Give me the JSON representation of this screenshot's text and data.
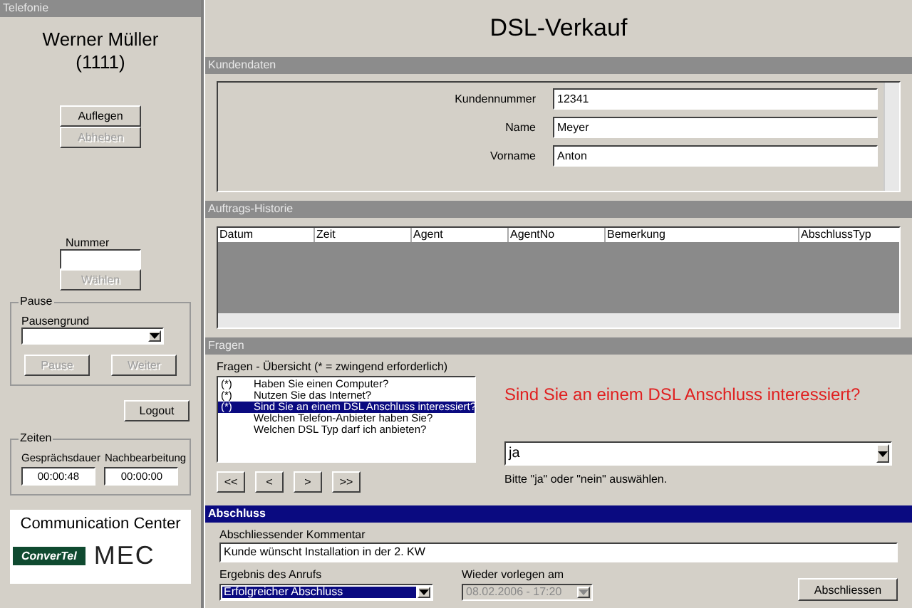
{
  "telefonie": {
    "header": "Telefonie",
    "agent_name": "Werner Müller",
    "agent_number": "(1111)",
    "call_buttons": [
      {
        "label": "Auflegen",
        "disabled": false
      },
      {
        "label": "Abheben",
        "disabled": true
      }
    ],
    "number_label": "Nummer",
    "dial_button": {
      "label": "Wählen",
      "disabled": true
    },
    "pause": {
      "legend": "Pause",
      "reason_label": "Pausengrund",
      "buttons": [
        {
          "label": "Pause",
          "disabled": true
        },
        {
          "label": "Weiter",
          "disabled": true
        }
      ]
    },
    "logout_button": "Logout",
    "zeiten": {
      "legend": "Zeiten",
      "timers": [
        {
          "label": "Gesprächsdauer",
          "value": "00:00:48"
        },
        {
          "label": "Nachbearbeitung",
          "value": "00:00:00"
        }
      ]
    },
    "logo": {
      "title": "Communication Center",
      "brand": "ConverTel",
      "mark": "MEC"
    }
  },
  "title": "DSL-Verkauf",
  "kundendaten": {
    "header": "Kundendaten",
    "fields": [
      {
        "label": "Kundennummer",
        "value": "12341"
      },
      {
        "label": "Name",
        "value": "Meyer"
      },
      {
        "label": "Vorname",
        "value": "Anton"
      }
    ]
  },
  "historie": {
    "header": "Auftrags-Historie",
    "columns": [
      "Datum",
      "Zeit",
      "Agent",
      "AgentNo",
      "Bemerkung",
      "AbschlussTyp"
    ]
  },
  "fragen": {
    "header": "Fragen",
    "list_label": "Fragen - Übersicht (* =  zwingend erforderlich)",
    "questions": [
      {
        "mark": "(*)",
        "text": "Haben Sie einen Computer?",
        "selected": false
      },
      {
        "mark": "(*)",
        "text": "Nutzen Sie das Internet?",
        "selected": false
      },
      {
        "mark": "(*)",
        "text": "Sind Sie an einem DSL Anschluss interessiert?",
        "selected": true
      },
      {
        "text": "Welchen Telefon-Anbieter haben Sie?",
        "selected": false
      },
      {
        "text": "Welchen DSL Typ darf ich anbieten?",
        "selected": false
      }
    ],
    "nav_buttons": [
      "<<",
      "<",
      ">",
      ">>"
    ],
    "current_question": "Sind Sie an einem DSL Anschluss interessiert?",
    "answer": "ja",
    "hint": "Bitte \"ja\" oder \"nein\" auswählen."
  },
  "abschluss": {
    "header": "Abschluss",
    "comment_label": "Abschliessender Kommentar",
    "comment": "Kunde wünscht Installation in der 2. KW",
    "result_label": "Ergebnis des Anrufs",
    "result": "Erfolgreicher Abschluss",
    "resubmit_label": "Wieder vorlegen am",
    "resubmit": "08.02.2006 - 17:20",
    "resubmit_disabled": true,
    "submit_button": "Abschliessen"
  }
}
